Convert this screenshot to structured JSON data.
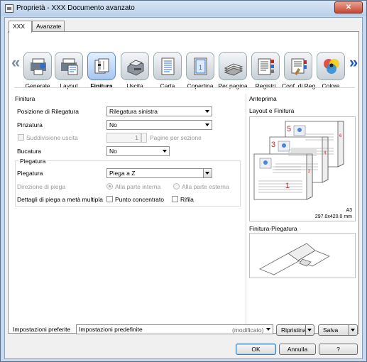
{
  "window": {
    "title": "Proprietà - XXX Documento avanzato",
    "close_label": "✕"
  },
  "tabs": [
    {
      "label": "XXX"
    },
    {
      "label": "Avanzate"
    }
  ],
  "categories": [
    {
      "label": "Generale"
    },
    {
      "label": "Layout"
    },
    {
      "label": "Finitura"
    },
    {
      "label": "Uscita"
    },
    {
      "label": "Carta"
    },
    {
      "label": "Copertina"
    },
    {
      "label": "Per pagina"
    },
    {
      "label": "Registri"
    },
    {
      "label": "Conf. di Reg."
    },
    {
      "label": "Colore"
    }
  ],
  "finitura": {
    "section_title": "Finitura",
    "posizione_label": "Posizione di Rilegatura",
    "posizione_value": "Rilegatura sinistra",
    "pinzatura_label": "Pinzatura",
    "pinzatura_value": "No",
    "suddivisione_label": "Suddivisione uscita",
    "suddivisione_value": "1",
    "pagine_label": "Pagine per sezione",
    "bucatura_label": "Bucatura",
    "bucatura_value": "No",
    "piegatura_group_title": "Piegatura",
    "piegatura_label": "Piegatura",
    "piegatura_value": "Piega a Z",
    "direzione_label": "Direzione di piega",
    "radio_interna": "Alla parte interna",
    "radio_esterna": "Alla parte esterna",
    "dettagli_label": "Dettagli di piega a metà multipla",
    "punto_label": "Punto concentrato",
    "rifila_label": "Rifila"
  },
  "preview": {
    "title": "Anteprima",
    "layout_label": "Layout e Finitura",
    "paper_size": "A3",
    "paper_dims": "297.0x420.0 mm",
    "piegatura_label": "Finitura-Piegatura",
    "page_numbers": [
      "1",
      "2",
      "3",
      "4",
      "5",
      "6"
    ]
  },
  "footer": {
    "preferite_label": "Impostazioni preferite",
    "preferite_value": "Impostazioni predefinite",
    "modified_label": "(modificato)",
    "ripristina_label": "Ripristina",
    "salva_label": "Salva",
    "ok_label": "OK",
    "annulla_label": "Annulla",
    "help_label": "?"
  },
  "colors": {
    "accent": "#1a55c8",
    "page_number_red": "#c0282a"
  }
}
